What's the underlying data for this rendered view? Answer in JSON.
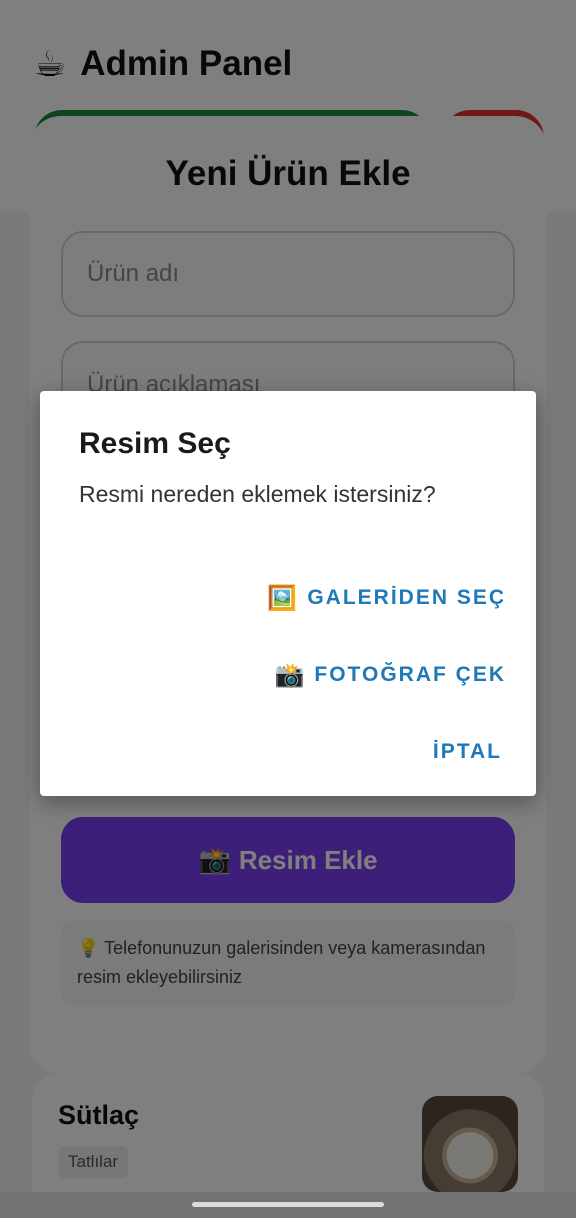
{
  "header": {
    "icon": "coffee-cup-icon",
    "title": "Admin Panel",
    "buttons": [
      {
        "name": "green-action-button",
        "color": "#1e8b3a"
      },
      {
        "name": "red-action-button",
        "color": "#e03030"
      }
    ]
  },
  "add_product": {
    "title": "Yeni Ürün Ekle",
    "name_placeholder": "Ürün adı",
    "description_placeholder": "Ürün açıklaması",
    "image_button_icon": "camera-icon",
    "image_button_label": "Resim Ekle",
    "tip_icon": "lightbulb-icon",
    "tip_text": "Telefonunuzun galerisinden veya kamerasından resim ekleyebilirsiniz"
  },
  "product_card": {
    "name": "Sütlaç",
    "category": "Tatlılar"
  },
  "dialog": {
    "title": "Resim Seç",
    "message": "Resmi nereden eklemek istersiniz?",
    "gallery_icon": "picture-icon",
    "gallery_label": "GALERİDEN SEÇ",
    "camera_icon": "camera-flash-icon",
    "camera_label": "FOTOĞRAF ÇEK",
    "cancel_label": "İPTAL",
    "accent_color": "#1f78b8"
  },
  "colors": {
    "primary_purple": "#7b3ff2",
    "scrim": "rgba(0,0,0,0.5)"
  }
}
